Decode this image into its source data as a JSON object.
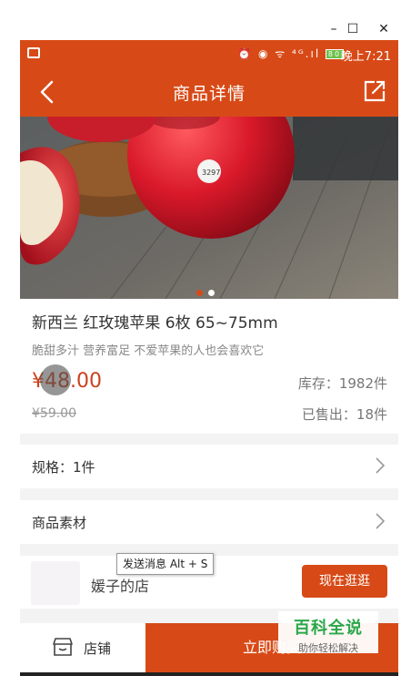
{
  "window": {
    "minimize_glyph": "–",
    "maximize_glyph": "☐",
    "close_glyph": "✕"
  },
  "statusbar": {
    "icons_text": "⏰ ◉ ᯤ ⁴ᴳ.ıl",
    "battery": "80",
    "time": "晚上7:21"
  },
  "appbar": {
    "title": "商品详情",
    "back_icon": "chevron-left",
    "share_icon": "share-edit"
  },
  "carousel": {
    "dot_colors": [
      "#d74a17",
      "#ffffff"
    ],
    "sticker_text": "3297"
  },
  "product": {
    "title": "新西兰 红玫瑰苹果 6枚 65~75mm",
    "subtitle": "脆甜多汁 营养富足 不爱苹果的人也会喜欢它",
    "price": "¥48.00",
    "original_price": "¥59.00",
    "stock": "库存：1982件",
    "sold": "已售出：18件"
  },
  "rows": {
    "spec": "规格：1件",
    "material": "商品素材"
  },
  "shop": {
    "name": "媛子的店",
    "visit_label": "现在逛逛"
  },
  "tooltip": {
    "text": "发送消息 Alt + S"
  },
  "bottombar": {
    "store_label": "店铺",
    "buy_label": "立即购买"
  },
  "watermark": {
    "main": "百科全说",
    "sub": "助你轻松解决"
  },
  "colors": {
    "accent": "#d74a17",
    "price": "#c9421c",
    "watermark_green": "#2aa84a"
  }
}
